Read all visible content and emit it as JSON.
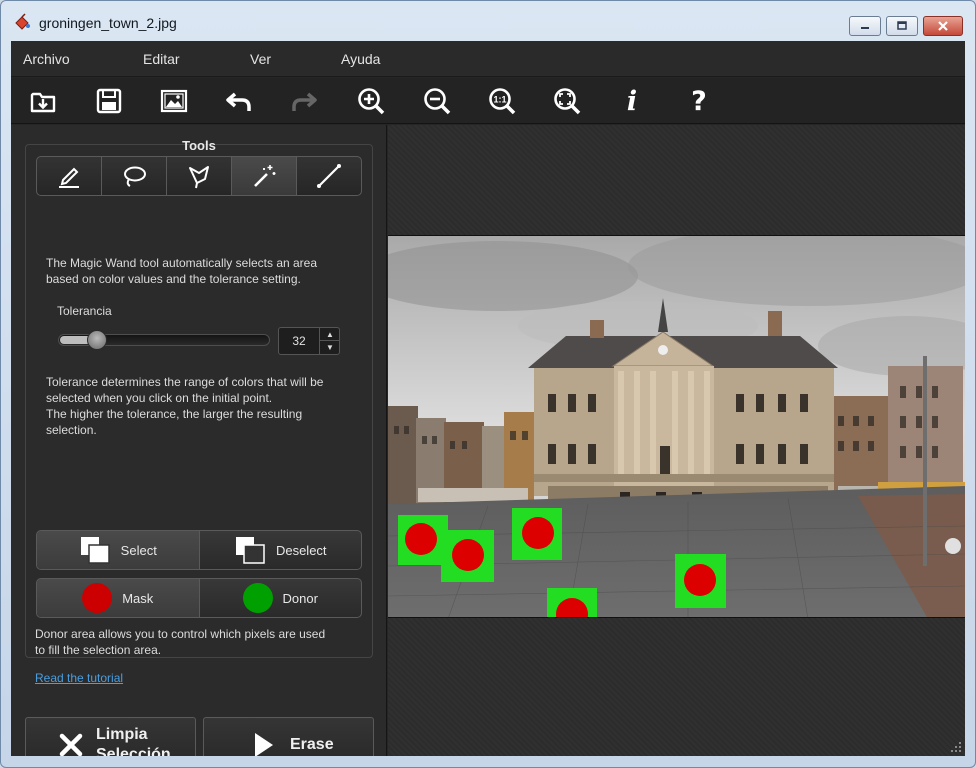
{
  "window": {
    "title": "groningen_town_2.jpg",
    "icon": "paint-bucket-icon",
    "controls": [
      "minimize-icon",
      "maximize-icon",
      "close-icon"
    ]
  },
  "menu": {
    "items": [
      {
        "label": "Archivo"
      },
      {
        "label": "Editar"
      },
      {
        "label": "Ver"
      },
      {
        "label": "Ayuda"
      }
    ]
  },
  "toolbar": {
    "buttons": [
      {
        "icon": "open-icon"
      },
      {
        "icon": "save-icon"
      },
      {
        "icon": "image-icon"
      },
      {
        "icon": "undo-icon"
      },
      {
        "icon": "redo-icon",
        "enabled": false
      },
      {
        "icon": "zoom-in-icon"
      },
      {
        "icon": "zoom-out-icon"
      },
      {
        "icon": "zoom-actual-size-icon",
        "glyph": "1:1"
      },
      {
        "icon": "zoom-fit-icon"
      },
      {
        "icon": "info-icon",
        "glyph": "i"
      },
      {
        "icon": "help-icon",
        "glyph": "?"
      }
    ]
  },
  "tools": {
    "heading": "Tools",
    "items": [
      {
        "icon": "marker-icon"
      },
      {
        "icon": "lasso-icon"
      },
      {
        "icon": "polygonal-lasso-icon"
      },
      {
        "icon": "magic-wand-icon",
        "active": true
      },
      {
        "icon": "line-icon"
      }
    ],
    "description_lines": [
      "The Magic Wand tool automatically selects an area",
      "based on color values and the tolerance setting."
    ],
    "tolerance": {
      "label": "Tolerancia",
      "value": "32",
      "fraction": 0.15
    },
    "tolerance_help_lines": [
      "Tolerance determines the range of colors that will be",
      "selected when you click on the initial point.",
      "The higher the tolerance, the larger the resulting",
      "selection."
    ],
    "selection_mode": {
      "select": "Select",
      "deselect": "Deselect",
      "active": "select"
    },
    "area_mode": {
      "mask": "Mask",
      "donor": "Donor",
      "mask_color": "#cc0000",
      "donor_color": "#00a000"
    },
    "donor_help_lines": [
      "Donor area allows you to control which pixels are used",
      "to fill the selection area."
    ],
    "tutorial_link": "Read the tutorial"
  },
  "actions": {
    "clear_line1": "Limpia",
    "clear_line2": "Selección",
    "erase": "Erase"
  },
  "colors": {
    "selection_green": "#22dd22",
    "mask_red": "#dd0000",
    "link": "#4a9ee0"
  }
}
